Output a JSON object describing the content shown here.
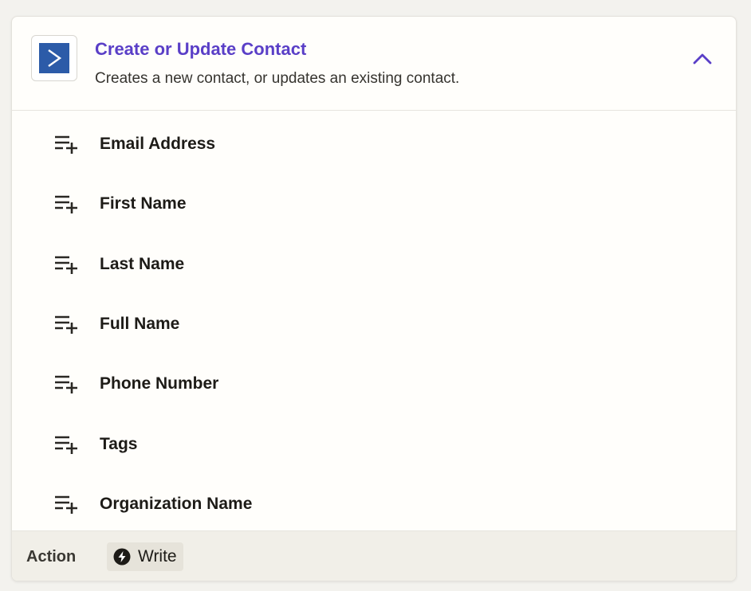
{
  "header": {
    "title": "Create or Update Contact",
    "subtitle": "Creates a new contact, or updates an existing contact.",
    "app_icon": "activecampaign-logo",
    "collapse_icon": "chevron-up-icon",
    "title_color": "#5a3fc7",
    "logo_color": "#2c5ba8"
  },
  "fields": [
    {
      "label": "Email Address",
      "icon": "list-add-icon"
    },
    {
      "label": "First Name",
      "icon": "list-add-icon"
    },
    {
      "label": "Last Name",
      "icon": "list-add-icon"
    },
    {
      "label": "Full Name",
      "icon": "list-add-icon"
    },
    {
      "label": "Phone Number",
      "icon": "list-add-icon"
    },
    {
      "label": "Tags",
      "icon": "list-add-icon"
    },
    {
      "label": "Organization Name",
      "icon": "list-add-icon"
    }
  ],
  "footer": {
    "label": "Action",
    "badge_text": "Write",
    "badge_icon": "bolt-icon"
  }
}
